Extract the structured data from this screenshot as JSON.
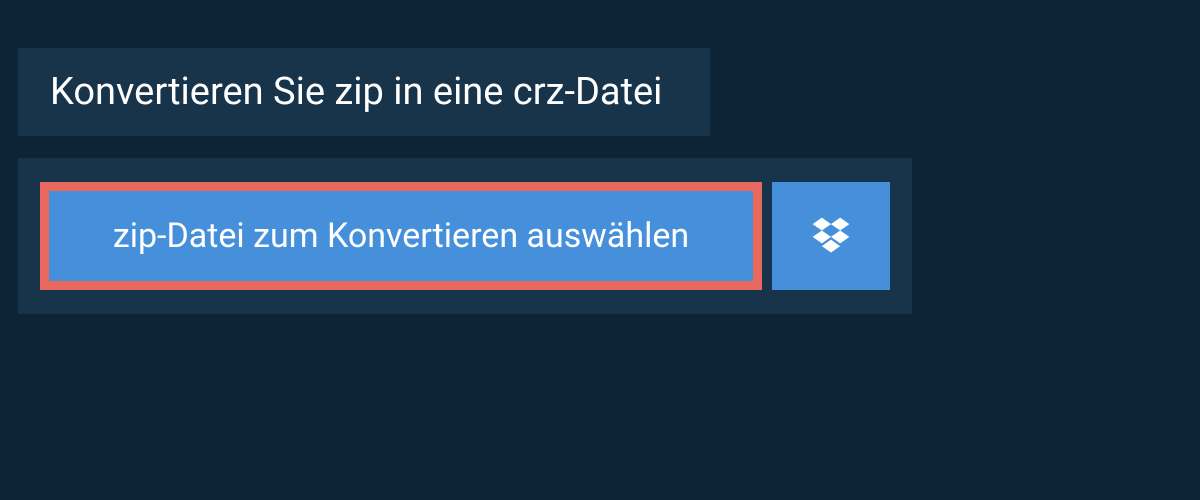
{
  "heading": "Konvertieren Sie zip in eine crz-Datei",
  "selectButton": {
    "label": "zip-Datei zum Konvertieren auswählen"
  },
  "dropbox": {
    "iconName": "dropbox-icon"
  },
  "colors": {
    "pageBg": "#0d2436",
    "panelBg": "#17344b",
    "buttonBg": "#4690db",
    "highlightBorder": "#e86a5f",
    "text": "#ffffff"
  }
}
